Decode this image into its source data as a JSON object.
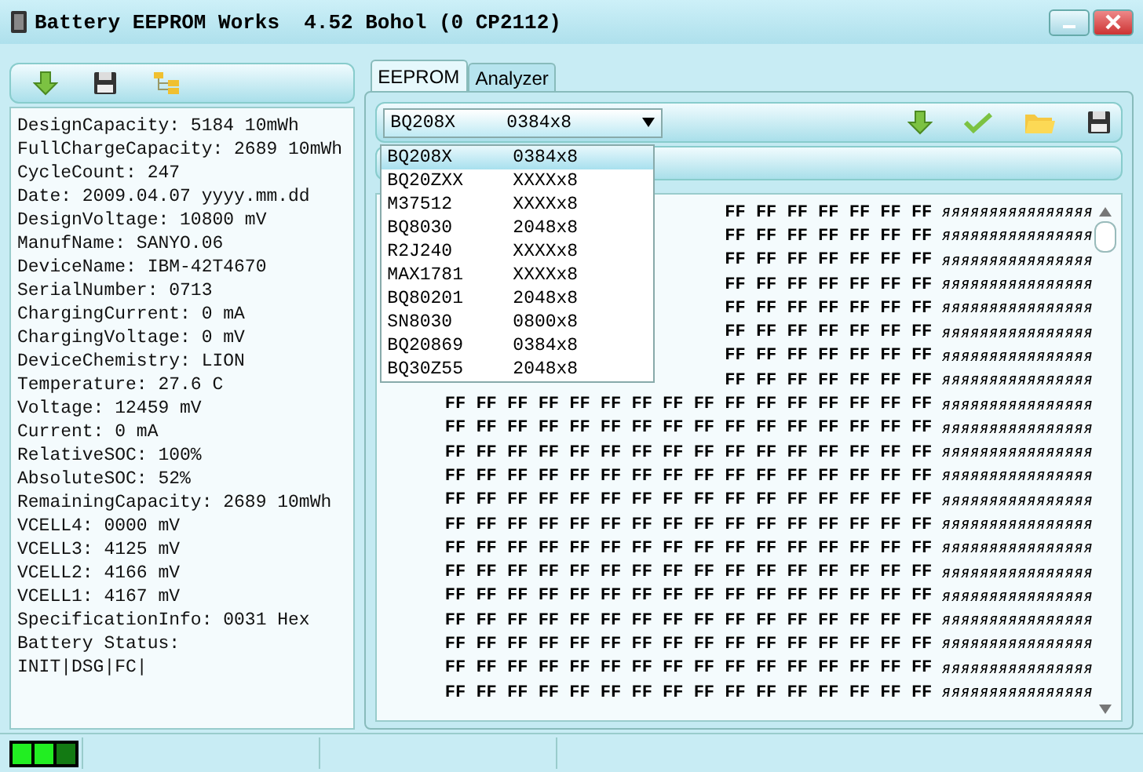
{
  "window": {
    "title": "Battery EEPROM Works  4.52 Bohol (0 CP2112)"
  },
  "info_lines": [
    "DesignCapacity: 5184 10mWh",
    "FullChargeCapacity: 2689 10mWh",
    "CycleCount: 247",
    "Date: 2009.04.07 yyyy.mm.dd",
    "DesignVoltage: 10800 mV",
    "ManufName: SANYO.06",
    "DeviceName: IBM-42T4670",
    "SerialNumber: 0713",
    "ChargingCurrent: 0 mA",
    "ChargingVoltage: 0 mV",
    "DeviceChemistry: LION",
    "Temperature: 27.6 C",
    "Voltage: 12459 mV",
    "Current: 0 mA",
    "RelativeSOC: 100%",
    "AbsoluteSOC: 52%",
    "RemainingCapacity: 2689 10mWh",
    "VCELL4: 0000 mV",
    "VCELL3: 4125 mV",
    "VCELL2: 4166 mV",
    "VCELL1: 4167 mV",
    "SpecificationInfo: 0031 Hex",
    "Battery Status:",
    "INIT|DSG|FC|"
  ],
  "tabs": [
    {
      "label": "EEPROM",
      "selected": true
    },
    {
      "label": "Analyzer",
      "selected": false
    }
  ],
  "chip_select": {
    "name": "BQ208X",
    "size": "0384x8",
    "options": [
      {
        "name": "BQ208X",
        "size": "0384x8",
        "selected": true
      },
      {
        "name": "BQ20ZXX",
        "size": "XXXXx8",
        "selected": false
      },
      {
        "name": "M37512",
        "size": "XXXXx8",
        "selected": false
      },
      {
        "name": "BQ8030",
        "size": "2048x8",
        "selected": false
      },
      {
        "name": "R2J240",
        "size": "XXXXx8",
        "selected": false
      },
      {
        "name": "MAX1781",
        "size": "XXXXx8",
        "selected": false
      },
      {
        "name": "BQ80201",
        "size": "2048x8",
        "selected": false
      },
      {
        "name": "SN8030",
        "size": "0800x8",
        "selected": false
      },
      {
        "name": "BQ20869",
        "size": "0384x8",
        "selected": false
      },
      {
        "name": "BQ30Z55",
        "size": "2048x8",
        "selected": false
      }
    ]
  },
  "hex": {
    "rows": [
      {
        "bytes": "FF FF FF FF FF FF FF",
        "ascii": "яяяяяяяяяяяяяяяя"
      },
      {
        "bytes": "FF FF FF FF FF FF FF",
        "ascii": "яяяяяяяяяяяяяяяя"
      },
      {
        "bytes": "FF FF FF FF FF FF FF",
        "ascii": "яяяяяяяяяяяяяяяя"
      },
      {
        "bytes": "FF FF FF FF FF FF FF",
        "ascii": "яяяяяяяяяяяяяяяя"
      },
      {
        "bytes": "FF FF FF FF FF FF FF",
        "ascii": "яяяяяяяяяяяяяяяя"
      },
      {
        "bytes": "FF FF FF FF FF FF FF",
        "ascii": "яяяяяяяяяяяяяяяя"
      },
      {
        "bytes": "FF FF FF FF FF FF FF",
        "ascii": "яяяяяяяяяяяяяяяя"
      },
      {
        "bytes": "FF FF FF FF FF FF FF",
        "ascii": "яяяяяяяяяяяяяяяя"
      },
      {
        "bytes": "FF FF FF FF FF FF FF FF FF FF FF FF FF FF FF FF",
        "ascii": "яяяяяяяяяяяяяяяя"
      },
      {
        "bytes": "FF FF FF FF FF FF FF FF FF FF FF FF FF FF FF FF",
        "ascii": "яяяяяяяяяяяяяяяя"
      },
      {
        "bytes": "FF FF FF FF FF FF FF FF FF FF FF FF FF FF FF FF",
        "ascii": "яяяяяяяяяяяяяяяя"
      },
      {
        "bytes": "FF FF FF FF FF FF FF FF FF FF FF FF FF FF FF FF",
        "ascii": "яяяяяяяяяяяяяяяя"
      },
      {
        "bytes": "FF FF FF FF FF FF FF FF FF FF FF FF FF FF FF FF",
        "ascii": "яяяяяяяяяяяяяяяя"
      },
      {
        "bytes": "FF FF FF FF FF FF FF FF FF FF FF FF FF FF FF FF",
        "ascii": "яяяяяяяяяяяяяяяя"
      },
      {
        "bytes": "FF FF FF FF FF FF FF FF FF FF FF FF FF FF FF FF",
        "ascii": "яяяяяяяяяяяяяяяя"
      },
      {
        "bytes": "FF FF FF FF FF FF FF FF FF FF FF FF FF FF FF FF",
        "ascii": "яяяяяяяяяяяяяяяя"
      },
      {
        "bytes": "FF FF FF FF FF FF FF FF FF FF FF FF FF FF FF FF",
        "ascii": "яяяяяяяяяяяяяяяя"
      },
      {
        "bytes": "FF FF FF FF FF FF FF FF FF FF FF FF FF FF FF FF",
        "ascii": "яяяяяяяяяяяяяяяя"
      },
      {
        "bytes": "FF FF FF FF FF FF FF FF FF FF FF FF FF FF FF FF",
        "ascii": "яяяяяяяяяяяяяяяя"
      },
      {
        "bytes": "FF FF FF FF FF FF FF FF FF FF FF FF FF FF FF FF",
        "ascii": "яяяяяяяяяяяяяяяя"
      },
      {
        "bytes": "FF FF FF FF FF FF FF FF FF FF FF FF FF FF FF FF",
        "ascii": "яяяяяяяяяяяяяяяя"
      }
    ]
  },
  "status_bar": {
    "indicators": [
      {
        "on": true
      },
      {
        "on": true
      },
      {
        "on": false
      }
    ]
  }
}
